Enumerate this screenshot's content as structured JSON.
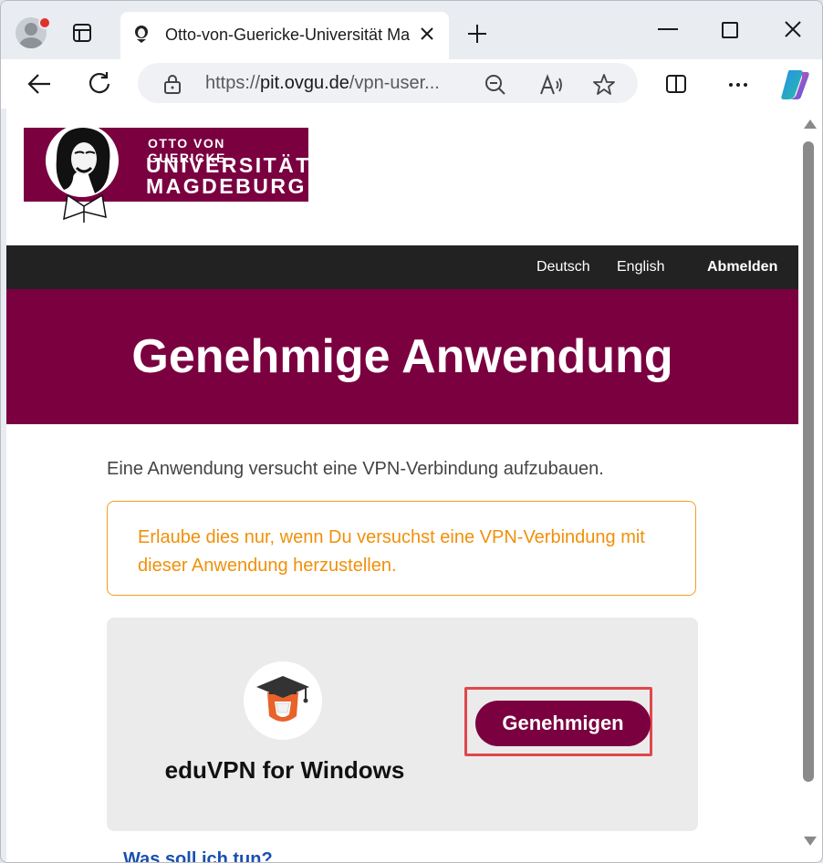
{
  "browser": {
    "tab_title": "Otto-von-Guericke-Universität Magdeburg",
    "url_scheme": "https://",
    "url_domain": "pit.ovgu.de",
    "url_path": "/vpn-user..."
  },
  "logo": {
    "line1": "OTTO VON GUERICKE",
    "line2": "UNIVERSITÄT",
    "line3": "MAGDEBURG"
  },
  "nav": {
    "deutsch": "Deutsch",
    "english": "English",
    "logout": "Abmelden"
  },
  "hero": {
    "title": "Genehmige Anwendung"
  },
  "content": {
    "intro": "Eine Anwendung versucht eine VPN-Verbindung aufzubauen.",
    "warning": "Erlaube dies nur, wenn Du versuchst eine VPN-Verbindung mit dieser Anwendung herzustellen.",
    "app_name": "eduVPN for Windows",
    "approve": "Genehmigen",
    "cut_off_link": "Was soll ich tun?"
  },
  "colors": {
    "brand": "#7a0040",
    "warning": "#f0900a",
    "highlight": "#e0474c"
  }
}
